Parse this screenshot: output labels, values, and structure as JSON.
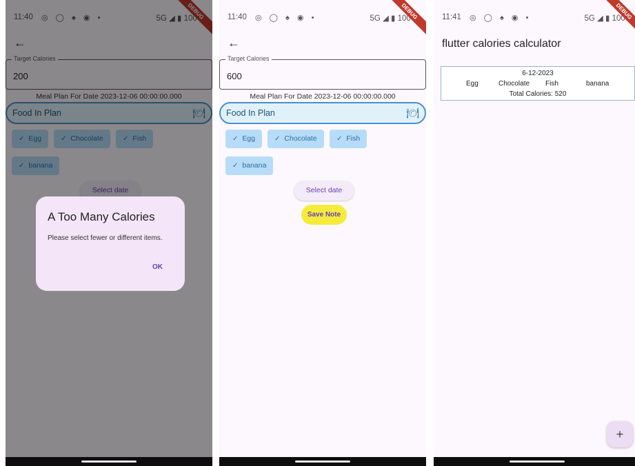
{
  "screen1": {
    "status_time": "11:40",
    "status_icons": "◎ ◯ ♠ ◉ •",
    "status_right": "5G ◢ ▮ 100%",
    "debug_label": "DEBUG",
    "back_icon": "←",
    "target_label": "Target Calories",
    "target_value": "200",
    "meal_header": "Meal Plan For Date 2023-12-06 00:00:00.000",
    "food_in_plan": "Food In Plan",
    "food_icon": "food-icon",
    "chips": [
      "Egg",
      "Chocolate",
      "Fish",
      "banana"
    ],
    "select_date": "Select date",
    "dialog": {
      "title": "A Too Many Calories",
      "message": "Please select fewer or different items.",
      "ok": "OK"
    }
  },
  "screen2": {
    "status_time": "11:40",
    "status_icons": "◎ ◯ ♠ ◉ •",
    "status_right": "5G ◢ ▮ 100%",
    "debug_label": "DEBUG",
    "back_icon": "←",
    "target_label": "Target Calories",
    "target_value": "600",
    "meal_header": "Meal Plan For Date 2023-12-06 00:00:00.000",
    "food_in_plan": "Food In Plan",
    "chips": [
      "Egg",
      "Chocolate",
      "Fish",
      "banana"
    ],
    "select_date": "Select date",
    "save_note": "Save Note"
  },
  "screen3": {
    "status_time": "11:41",
    "status_icons": "◎ ◯ ♠ ◉ •",
    "status_right": "5G ◢ ▮ 100%",
    "debug_label": "DEBUG",
    "title": "flutter calories calculator",
    "card": {
      "date": "6-12-2023",
      "foods": [
        "Egg",
        "Chocolate",
        "Fish",
        "banana"
      ],
      "total": "Total Calories: 520"
    },
    "fab": "+"
  },
  "colors": {
    "chip_bg": "#b7dcf7",
    "accent": "#6a3fb0",
    "save_button": "#f5eb3d",
    "debug_ribbon": "#c0392b"
  }
}
